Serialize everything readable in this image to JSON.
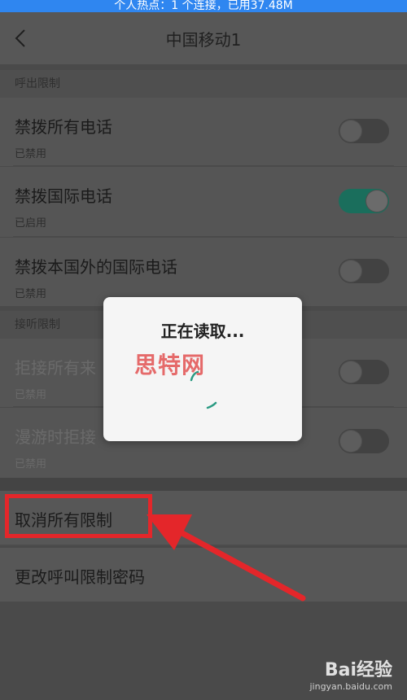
{
  "status": {
    "hotspot_text": "个人热点：1 个连接，已用37.48M"
  },
  "header": {
    "title": "中国移动1",
    "back_icon": "chevron-left-icon"
  },
  "sections": [
    {
      "label": "呼出限制",
      "items": [
        {
          "title": "禁拨所有电话",
          "status": "已禁用",
          "toggle": "off"
        },
        {
          "title": "禁拨国际电话",
          "status": "已启用",
          "toggle": "on"
        },
        {
          "title": "禁拨本国外的国际电话",
          "status": "已禁用",
          "toggle": "off"
        }
      ]
    },
    {
      "label": "接听限制",
      "items": [
        {
          "title": "拒接所有来",
          "status": "已禁用",
          "toggle": "off"
        },
        {
          "title": "漫游时拒接",
          "status": "已禁用",
          "toggle": "off"
        }
      ]
    }
  ],
  "actions": [
    {
      "label": "取消所有限制"
    },
    {
      "label": "更改呼叫限制密码"
    }
  ],
  "dialog": {
    "title": "正在读取..."
  },
  "watermark": {
    "text": "思特网"
  },
  "footer": {
    "logo_text": "Bai经验",
    "url": "jingyan.baidu.com"
  },
  "colors": {
    "accent_green": "#1a6e5c",
    "annotation_red": "#e4262a",
    "status_bar_blue": "#2f86f0"
  }
}
